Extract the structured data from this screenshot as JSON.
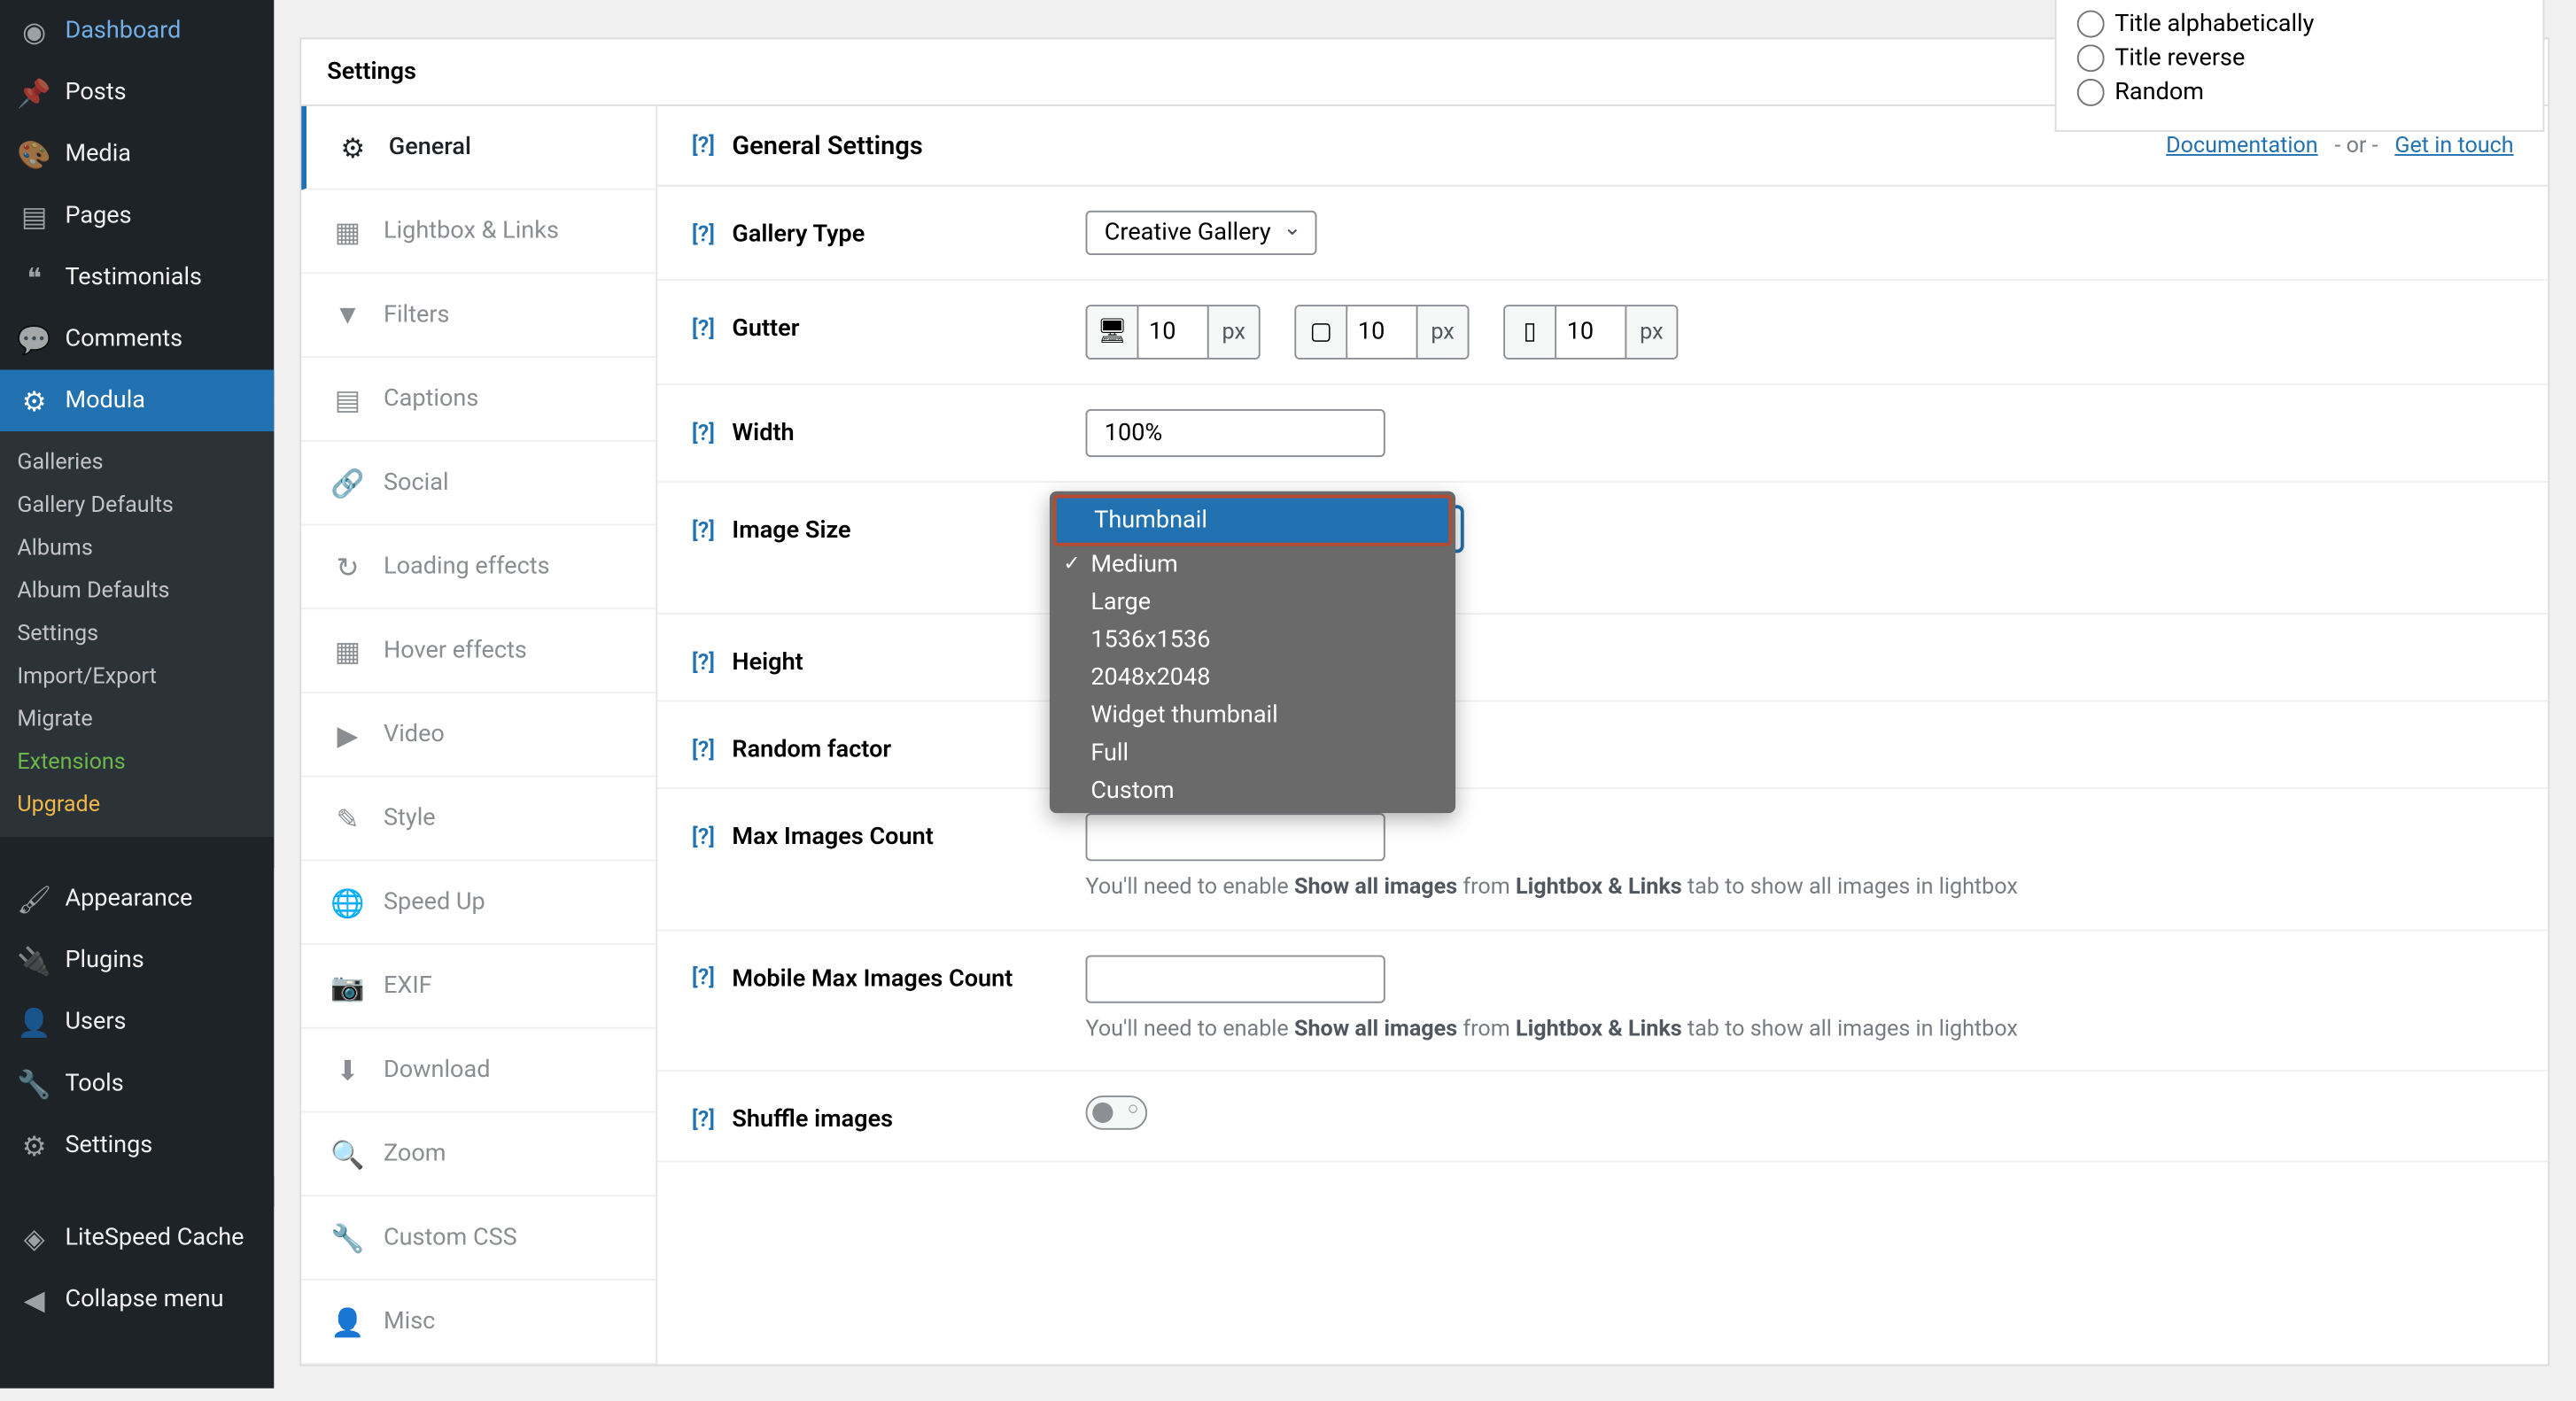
{
  "sidebar": {
    "items": [
      {
        "label": "Dashboard",
        "icon": "dashboard"
      },
      {
        "label": "Posts",
        "icon": "pin"
      },
      {
        "label": "Media",
        "icon": "media"
      },
      {
        "label": "Pages",
        "icon": "page"
      },
      {
        "label": "Testimonials",
        "icon": "quote"
      },
      {
        "label": "Comments",
        "icon": "comment"
      },
      {
        "label": "Modula",
        "icon": "modula"
      }
    ],
    "sub": [
      {
        "label": "Galleries"
      },
      {
        "label": "Gallery Defaults"
      },
      {
        "label": "Albums"
      },
      {
        "label": "Album Defaults"
      },
      {
        "label": "Settings"
      },
      {
        "label": "Import/Export"
      },
      {
        "label": "Migrate"
      },
      {
        "label": "Extensions",
        "cls": "ext"
      },
      {
        "label": "Upgrade",
        "cls": "upg"
      }
    ],
    "items2": [
      {
        "label": "Appearance",
        "icon": "brush"
      },
      {
        "label": "Plugins",
        "icon": "plug"
      },
      {
        "label": "Users",
        "icon": "user"
      },
      {
        "label": "Tools",
        "icon": "wrench"
      },
      {
        "label": "Settings",
        "icon": "sliders"
      },
      {
        "label": "LiteSpeed Cache",
        "icon": "ls"
      },
      {
        "label": "Collapse menu",
        "icon": "collapse"
      }
    ]
  },
  "panel": {
    "title": "Settings"
  },
  "tabs": [
    {
      "label": "General"
    },
    {
      "label": "Lightbox & Links"
    },
    {
      "label": "Filters"
    },
    {
      "label": "Captions"
    },
    {
      "label": "Social"
    },
    {
      "label": "Loading effects"
    },
    {
      "label": "Hover effects"
    },
    {
      "label": "Video"
    },
    {
      "label": "Style"
    },
    {
      "label": "Speed Up"
    },
    {
      "label": "EXIF"
    },
    {
      "label": "Download"
    },
    {
      "label": "Zoom"
    },
    {
      "label": "Custom CSS"
    },
    {
      "label": "Misc"
    }
  ],
  "content": {
    "title": "General Settings",
    "docs": "Documentation",
    "or": "- or -",
    "touch": "Get in touch",
    "rows": {
      "galleryType": {
        "label": "Gallery Type",
        "value": "Creative Gallery"
      },
      "gutter": {
        "label": "Gutter",
        "v1": "10",
        "v2": "10",
        "v3": "10",
        "unit": "px"
      },
      "width": {
        "label": "Width",
        "value": "100%"
      },
      "imageSize": {
        "label": "Image Size"
      },
      "height": {
        "label": "Height"
      },
      "randomFactor": {
        "label": "Random factor"
      },
      "maxImages": {
        "label": "Max Images Count",
        "hint1": "You'll need to enable ",
        "hint2": "Show all images",
        "hint3": " from ",
        "hint4": "Lightbox & Links",
        "hint5": " tab to show all images in lightbox"
      },
      "mobileMax": {
        "label": "Mobile Max Images Count",
        "hint1": "You'll need to enable ",
        "hint2": "Show all images",
        "hint3": " from ",
        "hint4": "Lightbox & Links",
        "hint5": " tab to show all images in lightbox"
      },
      "shuffle": {
        "label": "Shuffle images"
      }
    }
  },
  "dropdown": [
    {
      "label": "Thumbnail",
      "hl": true
    },
    {
      "label": "Medium",
      "checked": true
    },
    {
      "label": "Large"
    },
    {
      "label": "1536x1536"
    },
    {
      "label": "2048x2048"
    },
    {
      "label": "Widget thumbnail"
    },
    {
      "label": "Full"
    },
    {
      "label": "Custom"
    }
  ],
  "radios": [
    {
      "label": "Title alphabetically"
    },
    {
      "label": "Title reverse"
    },
    {
      "label": "Random"
    }
  ],
  "help": "[?]"
}
